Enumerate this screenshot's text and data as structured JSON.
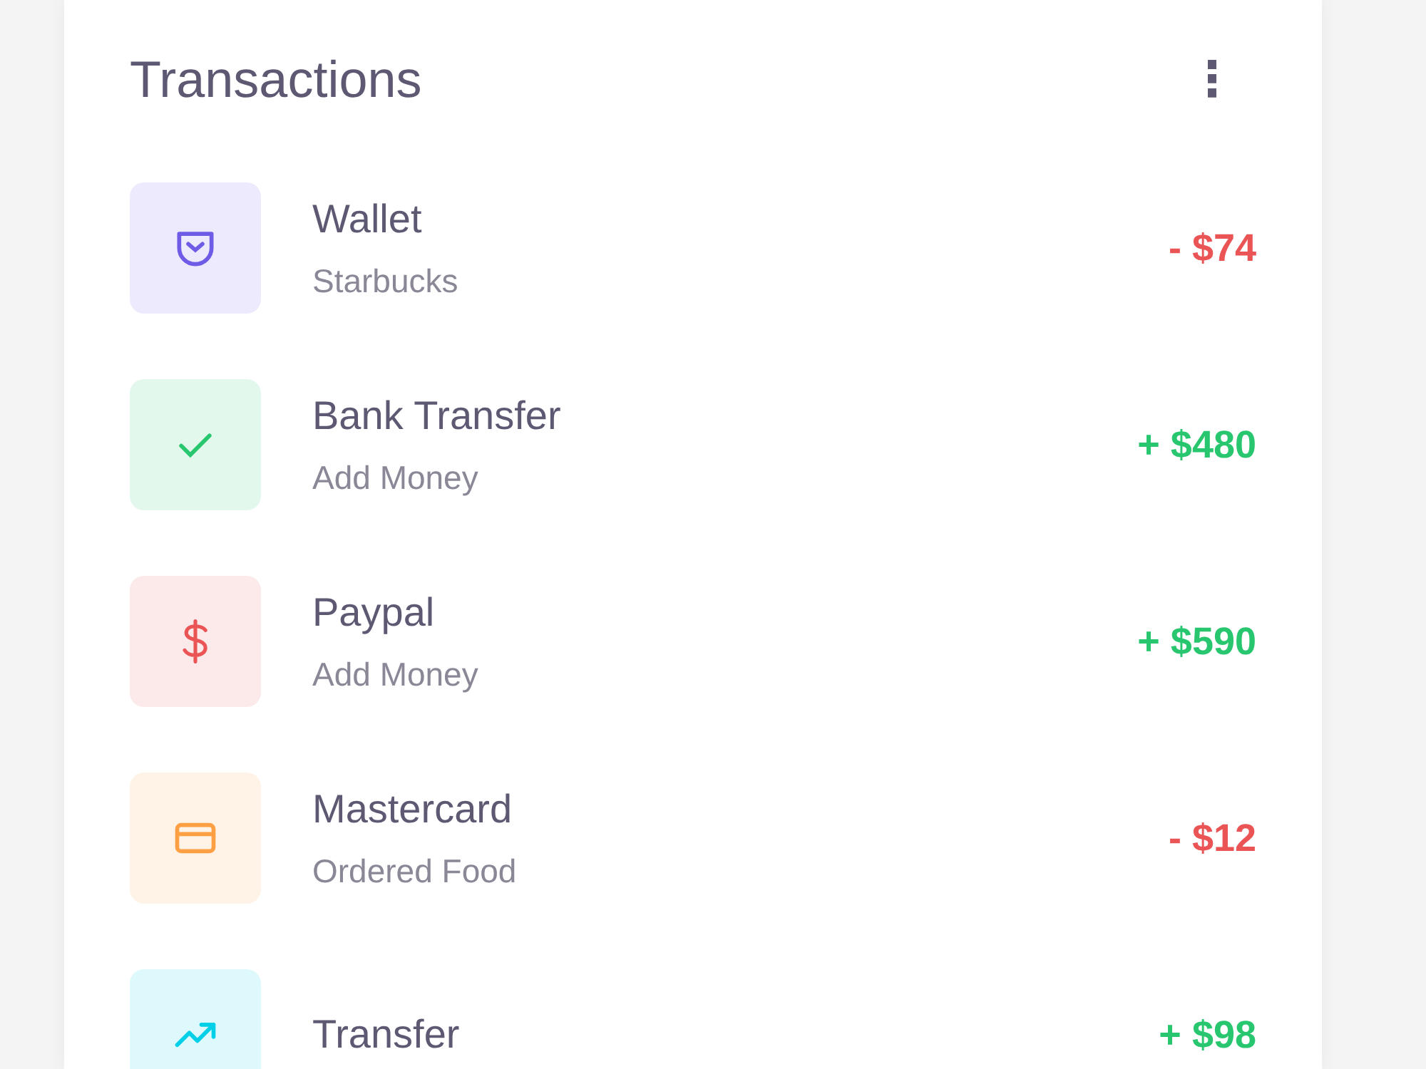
{
  "card": {
    "title": "Transactions",
    "menu_icon": "⋮",
    "transactions": [
      {
        "kind": "wallet",
        "color": "#6e5ce6",
        "title": "Wallet",
        "subtitle": "Starbucks",
        "negative": true,
        "amount": "- $74"
      },
      {
        "kind": "check",
        "color": "#28c76f",
        "title": "Bank Transfer",
        "subtitle": "Add Money",
        "negative": false,
        "amount": "+ $480"
      },
      {
        "kind": "dollar",
        "color": "#ea5455",
        "title": "Paypal",
        "subtitle": "Add Money",
        "negative": false,
        "amount": "+ $590"
      },
      {
        "kind": "card",
        "color": "#ff9f43",
        "title": "Mastercard",
        "subtitle": "Ordered Food",
        "negative": true,
        "amount": "- $12"
      },
      {
        "kind": "trend",
        "color": "#00cfe8",
        "title": "Transfer",
        "negative": false,
        "amount": "+ $98"
      }
    ]
  }
}
